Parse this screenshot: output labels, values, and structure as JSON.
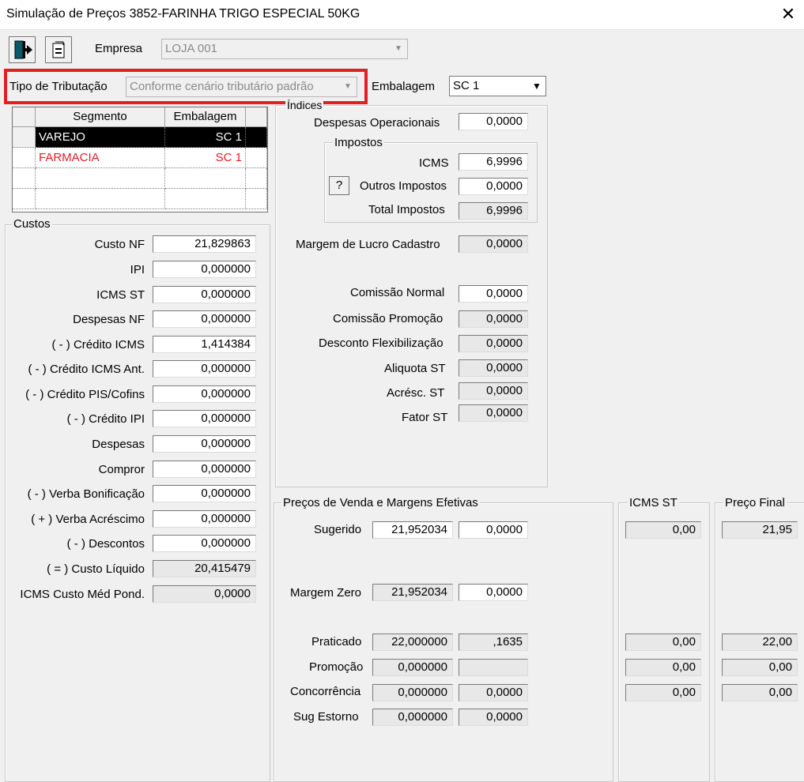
{
  "window": {
    "title": "Simulação de Preços  3852-FARINHA TRIGO ESPECIAL 50KG",
    "close_icon": "✕"
  },
  "toolbar": {
    "exit_icon": "exit-door-icon",
    "refresh_icon": "refresh-icon"
  },
  "empresa": {
    "label": "Empresa",
    "value": "LOJA 001"
  },
  "tributacao": {
    "label": "Tipo de Tributação",
    "value": "Conforme cenário tributário padrão"
  },
  "embalagem": {
    "label": "Embalagem",
    "value": "SC 1"
  },
  "segments": {
    "headers": [
      "Segmento",
      "Embalagem"
    ],
    "rows": [
      {
        "segmento": "VAREJO",
        "embalagem": "SC 1"
      },
      {
        "segmento": "FARMACIA",
        "embalagem": "SC 1"
      }
    ]
  },
  "custos": {
    "title": "Custos",
    "items": [
      {
        "label": "Custo NF",
        "value": "21,829863"
      },
      {
        "label": "IPI",
        "value": "0,000000"
      },
      {
        "label": "ICMS ST",
        "value": "0,000000"
      },
      {
        "label": "Despesas NF",
        "value": "0,000000"
      },
      {
        "label": "( - ) Crédito ICMS",
        "value": "1,414384"
      },
      {
        "label": "( - ) Crédito ICMS Ant.",
        "value": "0,000000"
      },
      {
        "label": "( - ) Crédito PIS/Cofins",
        "value": "0,000000"
      },
      {
        "label": "( - ) Crédito IPI",
        "value": "0,000000"
      },
      {
        "label": "Despesas",
        "value": "0,000000"
      },
      {
        "label": "Compror",
        "value": "0,000000"
      },
      {
        "label": "( - ) Verba Bonificação",
        "value": "0,000000"
      },
      {
        "label": "( + ) Verba Acréscimo",
        "value": "0,000000"
      },
      {
        "label": "( - ) Descontos",
        "value": "0,000000"
      },
      {
        "label": "( = ) Custo Líquido",
        "value": "20,415479"
      },
      {
        "label": "ICMS Custo Méd Pond.",
        "value": "0,0000"
      }
    ]
  },
  "indices": {
    "title": "Índices",
    "despesas_operacionais": {
      "label": "Despesas Operacionais",
      "value": "0,0000"
    },
    "impostos": {
      "title": "Impostos",
      "icms": {
        "label": "ICMS",
        "value": "6,9996"
      },
      "question_button": "?",
      "outros": {
        "label": "Outros Impostos",
        "value": "0,0000"
      },
      "total": {
        "label": "Total Impostos",
        "value": "6,9996"
      }
    },
    "margem_lucro": {
      "label": "Margem de Lucro Cadastro",
      "value": "0,0000"
    },
    "comissao_normal": {
      "label": "Comissão Normal",
      "value": "0,0000"
    },
    "comissao_promocao": {
      "label": "Comissão Promoção",
      "value": "0,0000"
    },
    "desconto_flex": {
      "label": "Desconto Flexibilização",
      "value": "0,0000"
    },
    "aliquota_st": {
      "label": "Aliquota ST",
      "value": "0,0000"
    },
    "acresc_st": {
      "label": "Acrésc. ST",
      "value": "0,0000"
    },
    "fator_st": {
      "label": "Fator ST",
      "value": "0,0000"
    }
  },
  "precos": {
    "title": "Preços de Venda e Margens Efetivas",
    "sugerido": {
      "label": "Sugerido",
      "preco": "21,952034",
      "margem": "0,0000"
    },
    "margem_zero": {
      "label": "Margem Zero",
      "preco": "21,952034",
      "margem": "0,0000"
    },
    "praticado": {
      "label": "Praticado",
      "preco": "22,000000",
      "margem": ",1635"
    },
    "promocao": {
      "label": "Promoção",
      "preco": "0,000000",
      "margem": ""
    },
    "concorrencia": {
      "label": "Concorrência",
      "preco": "0,000000",
      "margem": "0,0000"
    },
    "sug_estorno": {
      "label": "Sug Estorno",
      "preco": "0,000000",
      "margem": "0,0000"
    }
  },
  "icms_st": {
    "title": "ICMS ST",
    "values": [
      "0,00",
      "0,00",
      "0,00",
      "0,00"
    ]
  },
  "preco_final": {
    "title": "Preço Final",
    "values": [
      "21,95",
      "22,00",
      "0,00",
      "0,00"
    ]
  }
}
